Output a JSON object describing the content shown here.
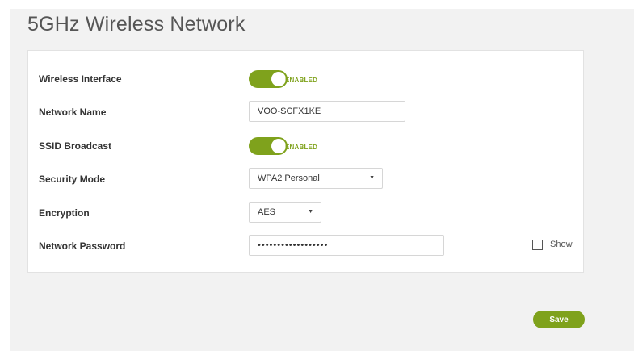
{
  "page": {
    "title": "5GHz Wireless Network"
  },
  "form": {
    "wireless_interface": {
      "label": "Wireless Interface",
      "state": "ENABLED"
    },
    "network_name": {
      "label": "Network Name",
      "value": "VOO-SCFX1KE"
    },
    "ssid_broadcast": {
      "label": "SSID Broadcast",
      "state": "ENABLED"
    },
    "security_mode": {
      "label": "Security Mode",
      "selected": "WPA2 Personal",
      "icon": "chevron-down-icon"
    },
    "encryption": {
      "label": "Encryption",
      "selected": "AES",
      "icon": "chevron-down-icon"
    },
    "network_password": {
      "label": "Network Password",
      "value": "••••••••••••••••••",
      "show_label": "Show",
      "show_checked": false
    }
  },
  "actions": {
    "save_label": "Save"
  },
  "colors": {
    "accent": "#7fa21c",
    "background": "#f2f2f2",
    "panel": "#ffffff"
  }
}
